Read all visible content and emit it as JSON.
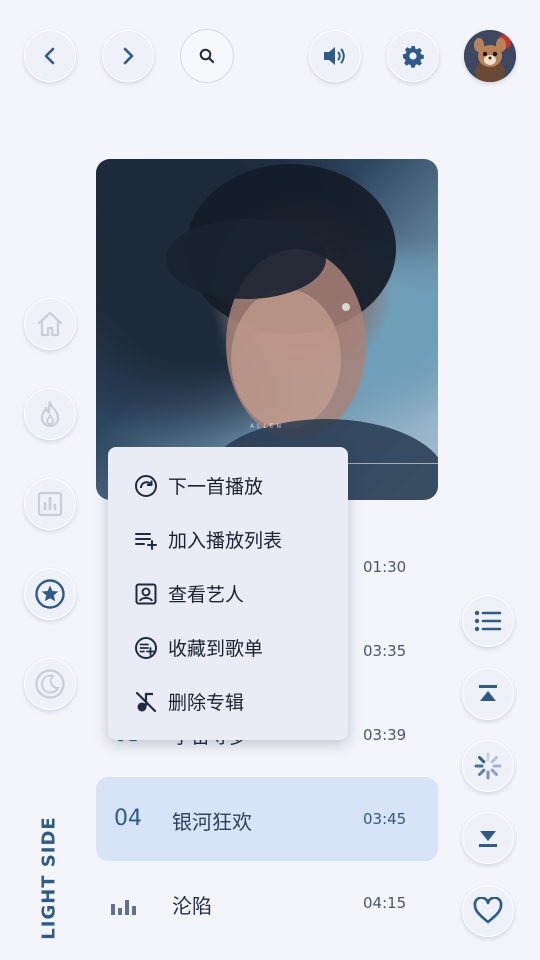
{
  "toolbar": {
    "back_icon": "chevron-left-icon",
    "forward_icon": "chevron-right-icon",
    "search_icon": "search-icon",
    "volume_icon": "volume-icon",
    "settings_icon": "gear-icon",
    "avatar": "user-avatar"
  },
  "sidebar": {
    "items": [
      {
        "icon": "home-icon"
      },
      {
        "icon": "fire-icon"
      },
      {
        "icon": "chart-icon"
      },
      {
        "icon": "star-icon"
      },
      {
        "icon": "moon-icon"
      }
    ],
    "brand": "LIGHT SIDE"
  },
  "album": {
    "watermark": "ALLEN"
  },
  "context_menu": {
    "items": [
      {
        "label": "下一首播放",
        "icon": "play-next-icon"
      },
      {
        "label": "加入播放列表",
        "icon": "add-to-playlist-icon"
      },
      {
        "label": "查看艺人",
        "icon": "artist-icon"
      },
      {
        "label": "收藏到歌单",
        "icon": "save-to-list-icon"
      },
      {
        "label": "删除专辑",
        "icon": "delete-album-icon"
      }
    ]
  },
  "tracks": [
    {
      "number": "",
      "title": "",
      "duration": "01:30"
    },
    {
      "number": "",
      "title": "",
      "duration": "03:35"
    },
    {
      "number": "03",
      "title": "宇宙寻梦",
      "duration": "03:39"
    },
    {
      "number": "04",
      "title": "银河狂欢",
      "duration": "03:45"
    },
    {
      "number": "",
      "title": "沦陷",
      "duration": "04:15"
    }
  ],
  "right_controls": {
    "items": [
      {
        "icon": "list-icon"
      },
      {
        "icon": "scroll-top-icon"
      },
      {
        "icon": "loading-icon"
      },
      {
        "icon": "scroll-bottom-icon"
      },
      {
        "icon": "heart-icon"
      }
    ]
  },
  "colors": {
    "accent": "#2f5b8a",
    "highlight_row": "#d7e3f6",
    "background": "#f3f5fb"
  }
}
